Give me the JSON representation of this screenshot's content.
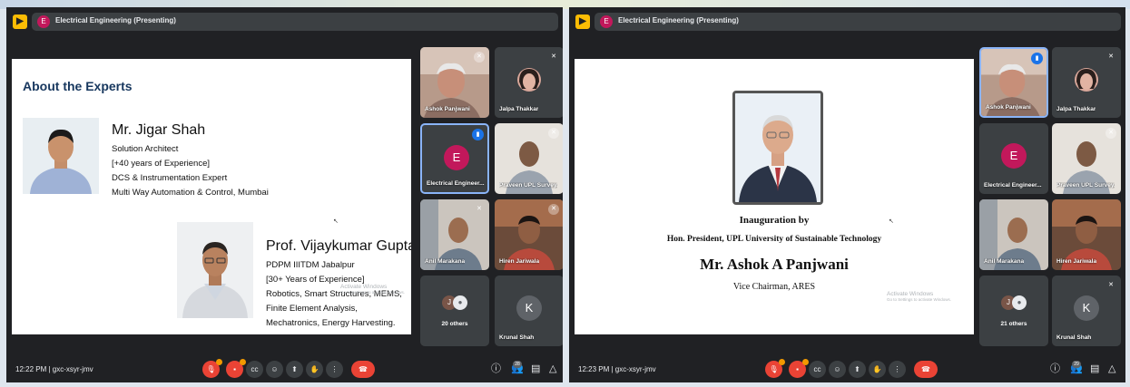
{
  "left": {
    "presenting_label": "Electrical Engineering (Presenting)",
    "presenter_initial": "E",
    "slide": {
      "title": "About the Experts",
      "expert1": {
        "name": "Mr. Jigar Shah",
        "lines": [
          "Solution Architect",
          "[+40 years of Experience]",
          "DCS & Instrumentation Expert",
          "Multi Way Automation & Control, Mumbai"
        ]
      },
      "expert2": {
        "name": "Prof. Vijaykumar Gupta",
        "lines": [
          "PDPM IIITDM Jabalpur",
          "[30+ Years of Experience]",
          "Robotics, Smart Structures, MEMS,",
          "Finite Element Analysis,",
          "Mechatronics, Energy Harvesting."
        ]
      },
      "watermark_title": "Activate Windows",
      "watermark_sub": "Go to Settings to activate Windows."
    },
    "tiles": {
      "t1": "Ashok Panjwani",
      "t2": "Jalpa Thakkar",
      "t3": "Electrical Engineer...",
      "t3_initial": "E",
      "t4": "Praveen UPL Survey...",
      "t5": "Anil Marakana",
      "t6": "Hiren Jariwala",
      "t7": "20 others",
      "t7_initial": "J",
      "t8": "Krunal Shah",
      "t8_initial": "K"
    },
    "bottom": {
      "time": "12:22 PM",
      "separator": "|",
      "code": "gxc-xsyr-jmv",
      "people_count": "28"
    }
  },
  "right": {
    "presenting_label": "Electrical Engineering (Presenting)",
    "presenter_initial": "E",
    "slide": {
      "line1": "Inauguration by",
      "line2": "Hon. President, UPL University of Sustainable Technology",
      "line3": "Mr. Ashok A Panjwani",
      "line4": "Vice Chairman, ARES",
      "watermark_title": "Activate Windows",
      "watermark_sub": "Go to Settings to activate Windows."
    },
    "tiles": {
      "t1": "Ashok Panjwani",
      "t2": "Jalpa Thakkar",
      "t3": "Electrical Engineer...",
      "t3_initial": "E",
      "t4": "Praveen UPL Survey...",
      "t5": "Anil Marakana",
      "t6": "Hiren Jariwala",
      "t7": "21 others",
      "t7_initial": "J",
      "t8": "Krunal Shah",
      "t8_initial": "K"
    },
    "bottom": {
      "time": "12:23 PM",
      "separator": "|",
      "code": "gxc-xsyr-jmv",
      "people_count": "29"
    }
  },
  "icons": {
    "present": "present-icon",
    "mic_off": "mic-off-icon",
    "speaking": "speaking-icon",
    "controls": [
      "mic-icon",
      "camera-icon",
      "captions-icon",
      "emoji-icon",
      "present-screen-icon",
      "raise-hand-icon",
      "more-options-icon",
      "hang-up-icon"
    ],
    "right_controls": [
      "info-icon",
      "people-icon",
      "chat-icon",
      "activities-icon"
    ]
  },
  "colors": {
    "app_bg": "#202124",
    "tile_bg": "#3c4043",
    "hang_up": "#ea4335",
    "speaking_blue": "#1a73e8",
    "present_yellow": "#fbbc04",
    "slide_title": "#17375e",
    "presenter_avatar": "#c2185b"
  }
}
